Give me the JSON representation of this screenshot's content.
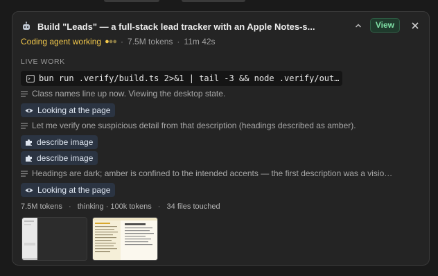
{
  "task": {
    "title": "Build \"Leads\" — a full-stack lead tracker with an Apple Notes-s...",
    "view_label": "View",
    "agent_status": "Coding agent working",
    "tokens": "7.5M tokens",
    "elapsed": "11m 42s"
  },
  "live_work": {
    "heading": "LIVE WORK",
    "command": "bun run .verify/build.ts 2>&1 | tail -3 && node .verify/out…"
  },
  "steps": [
    {
      "kind": "note",
      "text": "Class names line up now. Viewing the desktop state."
    },
    {
      "kind": "chip",
      "icon": "eye-icon",
      "text": "Looking at the page"
    },
    {
      "kind": "note",
      "text": "Let me verify one suspicious detail from that description (headings described as amber)."
    },
    {
      "kind": "chip",
      "icon": "puzzle-icon",
      "text": "describe image"
    },
    {
      "kind": "chip",
      "icon": "puzzle-icon",
      "text": "describe image"
    },
    {
      "kind": "note",
      "text": "Headings are dark; amber is confined to the intended accents — the first description was a visio…"
    },
    {
      "kind": "chip",
      "icon": "eye-icon",
      "text": "Looking at the page"
    }
  ],
  "footer": {
    "tokens": "7.5M tokens",
    "thinking": "thinking · 100k tokens",
    "files": "34 files touched"
  },
  "colors": {
    "accent_amber": "#f2c84b",
    "view_green": "#7fe0a6",
    "chip_bg": "#2b3442",
    "card_bg": "#242424"
  }
}
